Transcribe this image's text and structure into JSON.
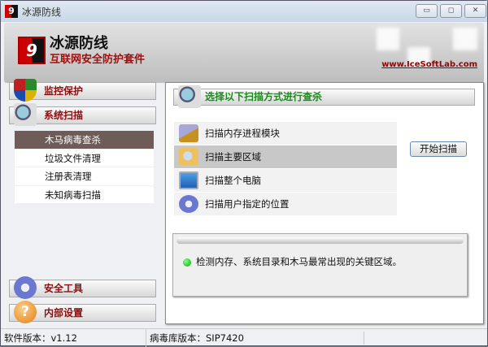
{
  "window": {
    "title": "冰源防线",
    "minimize": "▭",
    "maximize": "◻",
    "close": "✕"
  },
  "banner": {
    "logo_glyph": "9",
    "name": "冰源防线",
    "subtitle": "互联网安全防护套件",
    "url": "www.IceSoftLab.com"
  },
  "sidebar": {
    "sections": [
      {
        "label": "监控保护",
        "icon": "shield-icon"
      },
      {
        "label": "系统扫描",
        "icon": "magnifier-icon"
      },
      {
        "label": "安全工具",
        "icon": "gear-icon"
      },
      {
        "label": "内部设置",
        "icon": "help-icon"
      }
    ],
    "scan_items": [
      {
        "label": "木马病毒查杀",
        "selected": true
      },
      {
        "label": "垃圾文件清理"
      },
      {
        "label": "注册表清理"
      },
      {
        "label": "未知病毒扫描"
      }
    ]
  },
  "main": {
    "header": "选择以下扫描方式进行查杀",
    "options": [
      {
        "label": "扫描内存进程模块",
        "icon": "memory-chip-icon"
      },
      {
        "label": "扫描主要区域",
        "icon": "folder-search-icon",
        "selected": true
      },
      {
        "label": "扫描整个电脑",
        "icon": "computer-icon"
      },
      {
        "label": "扫描用户指定的位置",
        "icon": "gear-icon"
      }
    ],
    "start_button": "开始扫描",
    "description": "检测内存、系统目录和木马最常出现的关键区域。"
  },
  "status": {
    "software_version": "软件版本：v1.12",
    "virus_db_version": "病毒库版本：SIP7420"
  }
}
